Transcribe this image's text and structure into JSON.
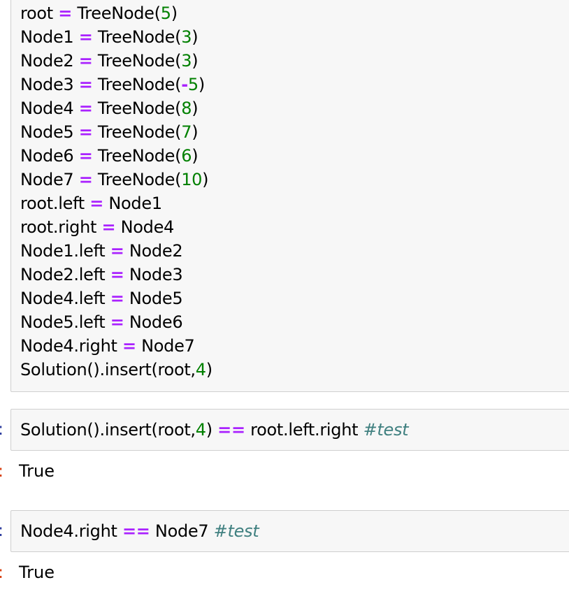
{
  "cells": [
    {
      "lines": [
        [
          {
            "t": "root "
          },
          {
            "t": "=",
            "c": "op"
          },
          {
            "t": " TreeNode("
          },
          {
            "t": "5",
            "c": "num"
          },
          {
            "t": ")"
          }
        ],
        [
          {
            "t": "Node1 "
          },
          {
            "t": "=",
            "c": "op"
          },
          {
            "t": " TreeNode("
          },
          {
            "t": "3",
            "c": "num"
          },
          {
            "t": ")"
          }
        ],
        [
          {
            "t": "Node2 "
          },
          {
            "t": "=",
            "c": "op"
          },
          {
            "t": " TreeNode("
          },
          {
            "t": "3",
            "c": "num"
          },
          {
            "t": ")"
          }
        ],
        [
          {
            "t": "Node3 "
          },
          {
            "t": "=",
            "c": "op"
          },
          {
            "t": " TreeNode("
          },
          {
            "t": "-",
            "c": "op"
          },
          {
            "t": "5",
            "c": "num"
          },
          {
            "t": ")"
          }
        ],
        [
          {
            "t": "Node4 "
          },
          {
            "t": "=",
            "c": "op"
          },
          {
            "t": " TreeNode("
          },
          {
            "t": "8",
            "c": "num"
          },
          {
            "t": ")"
          }
        ],
        [
          {
            "t": "Node5 "
          },
          {
            "t": "=",
            "c": "op"
          },
          {
            "t": " TreeNode("
          },
          {
            "t": "7",
            "c": "num"
          },
          {
            "t": ")"
          }
        ],
        [
          {
            "t": "Node6 "
          },
          {
            "t": "=",
            "c": "op"
          },
          {
            "t": " TreeNode("
          },
          {
            "t": "6",
            "c": "num"
          },
          {
            "t": ")"
          }
        ],
        [
          {
            "t": "Node7 "
          },
          {
            "t": "=",
            "c": "op"
          },
          {
            "t": " TreeNode("
          },
          {
            "t": "10",
            "c": "num"
          },
          {
            "t": ")"
          }
        ],
        [
          {
            "t": "root.left "
          },
          {
            "t": "=",
            "c": "op"
          },
          {
            "t": " Node1"
          }
        ],
        [
          {
            "t": "root.right "
          },
          {
            "t": "=",
            "c": "op"
          },
          {
            "t": " Node4"
          }
        ],
        [
          {
            "t": "Node1.left "
          },
          {
            "t": "=",
            "c": "op"
          },
          {
            "t": " Node2"
          }
        ],
        [
          {
            "t": "Node2.left "
          },
          {
            "t": "=",
            "c": "op"
          },
          {
            "t": " Node3"
          }
        ],
        [
          {
            "t": "Node4.left "
          },
          {
            "t": "=",
            "c": "op"
          },
          {
            "t": " Node5"
          }
        ],
        [
          {
            "t": "Node5.left "
          },
          {
            "t": "=",
            "c": "op"
          },
          {
            "t": " Node6"
          }
        ],
        [
          {
            "t": "Node4.right "
          },
          {
            "t": "=",
            "c": "op"
          },
          {
            "t": " Node7"
          }
        ],
        [
          {
            "t": "Solution().insert(root,"
          },
          {
            "t": "4",
            "c": "num"
          },
          {
            "t": ")"
          }
        ]
      ]
    },
    {
      "prompt": ":",
      "lines": [
        [
          {
            "t": "Solution().insert(root,"
          },
          {
            "t": "4",
            "c": "num"
          },
          {
            "t": ") "
          },
          {
            "t": "==",
            "c": "op"
          },
          {
            "t": " root.left.right "
          },
          {
            "t": "#test",
            "c": "cm"
          }
        ]
      ],
      "output_prompt": ":",
      "output": "True"
    },
    {
      "prompt": ":",
      "lines": [
        [
          {
            "t": "Node4.right "
          },
          {
            "t": "==",
            "c": "op"
          },
          {
            "t": " Node7 "
          },
          {
            "t": "#test",
            "c": "cm"
          }
        ]
      ],
      "output_prompt": ":",
      "output": "True"
    }
  ]
}
